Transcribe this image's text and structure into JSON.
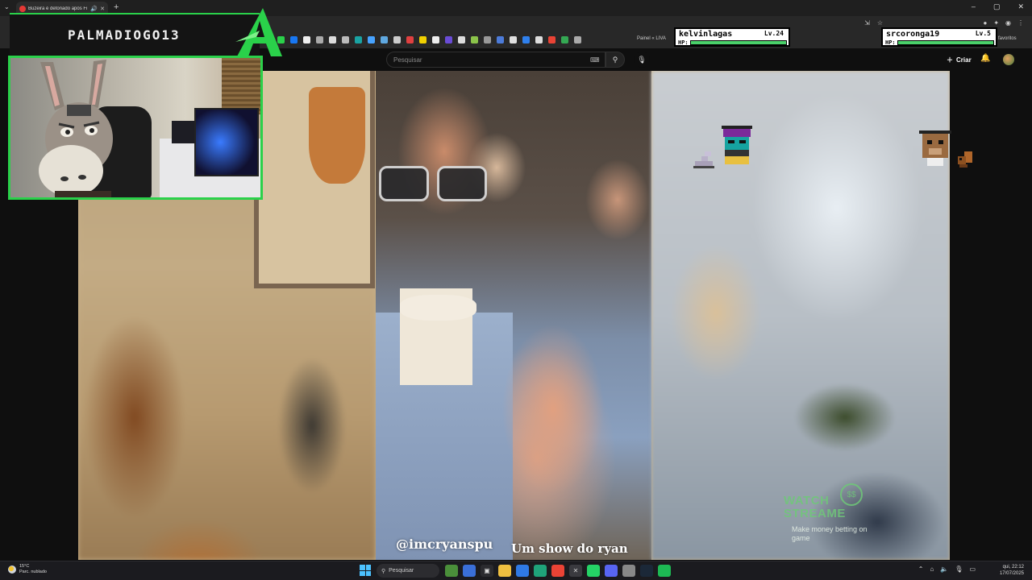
{
  "browser": {
    "tab_title": "Buzeira é detonado após Fi",
    "tab_audio_icon": "speaker-icon",
    "new_tab_label": "+",
    "bookmark_label": "Painel « LIVA",
    "other_bookmarks_label": "os favoritos",
    "window_controls": [
      "–",
      "▢",
      "✕"
    ]
  },
  "youtube": {
    "search_placeholder": "Pesquisar",
    "create_label": "Criar",
    "create_icon": "plus-icon"
  },
  "video": {
    "caption_handle": "@imcryanspu",
    "caption_show": "Um show do ryan",
    "watermark": {
      "coin": "$$",
      "title_line1": "WATCH",
      "title_line2": "STREAME",
      "subtitle": "Make money betting on game"
    }
  },
  "webcam": {
    "streamer_name": "PALMADIOGO13",
    "border_color": "#2ad14a"
  },
  "game_overlay": {
    "players": [
      {
        "name": "kelvinlagas",
        "level": "Lv.24",
        "hp_label": "HP:",
        "hp_fraction": 1.0
      },
      {
        "name": "srcoronga19",
        "level": "Lv.5",
        "hp_label": "HP:",
        "hp_fraction": 1.0
      }
    ]
  },
  "taskbar": {
    "weather_temp": "15°C",
    "weather_desc": "Parc. nublado",
    "search_label": "Pesquisar",
    "date": "17/07/2025",
    "time": "qui, 22:12"
  },
  "colors": {
    "accent_green": "#2ad14a",
    "yt_background": "#0f0f0f",
    "hp_bar": "#4ad06a"
  }
}
